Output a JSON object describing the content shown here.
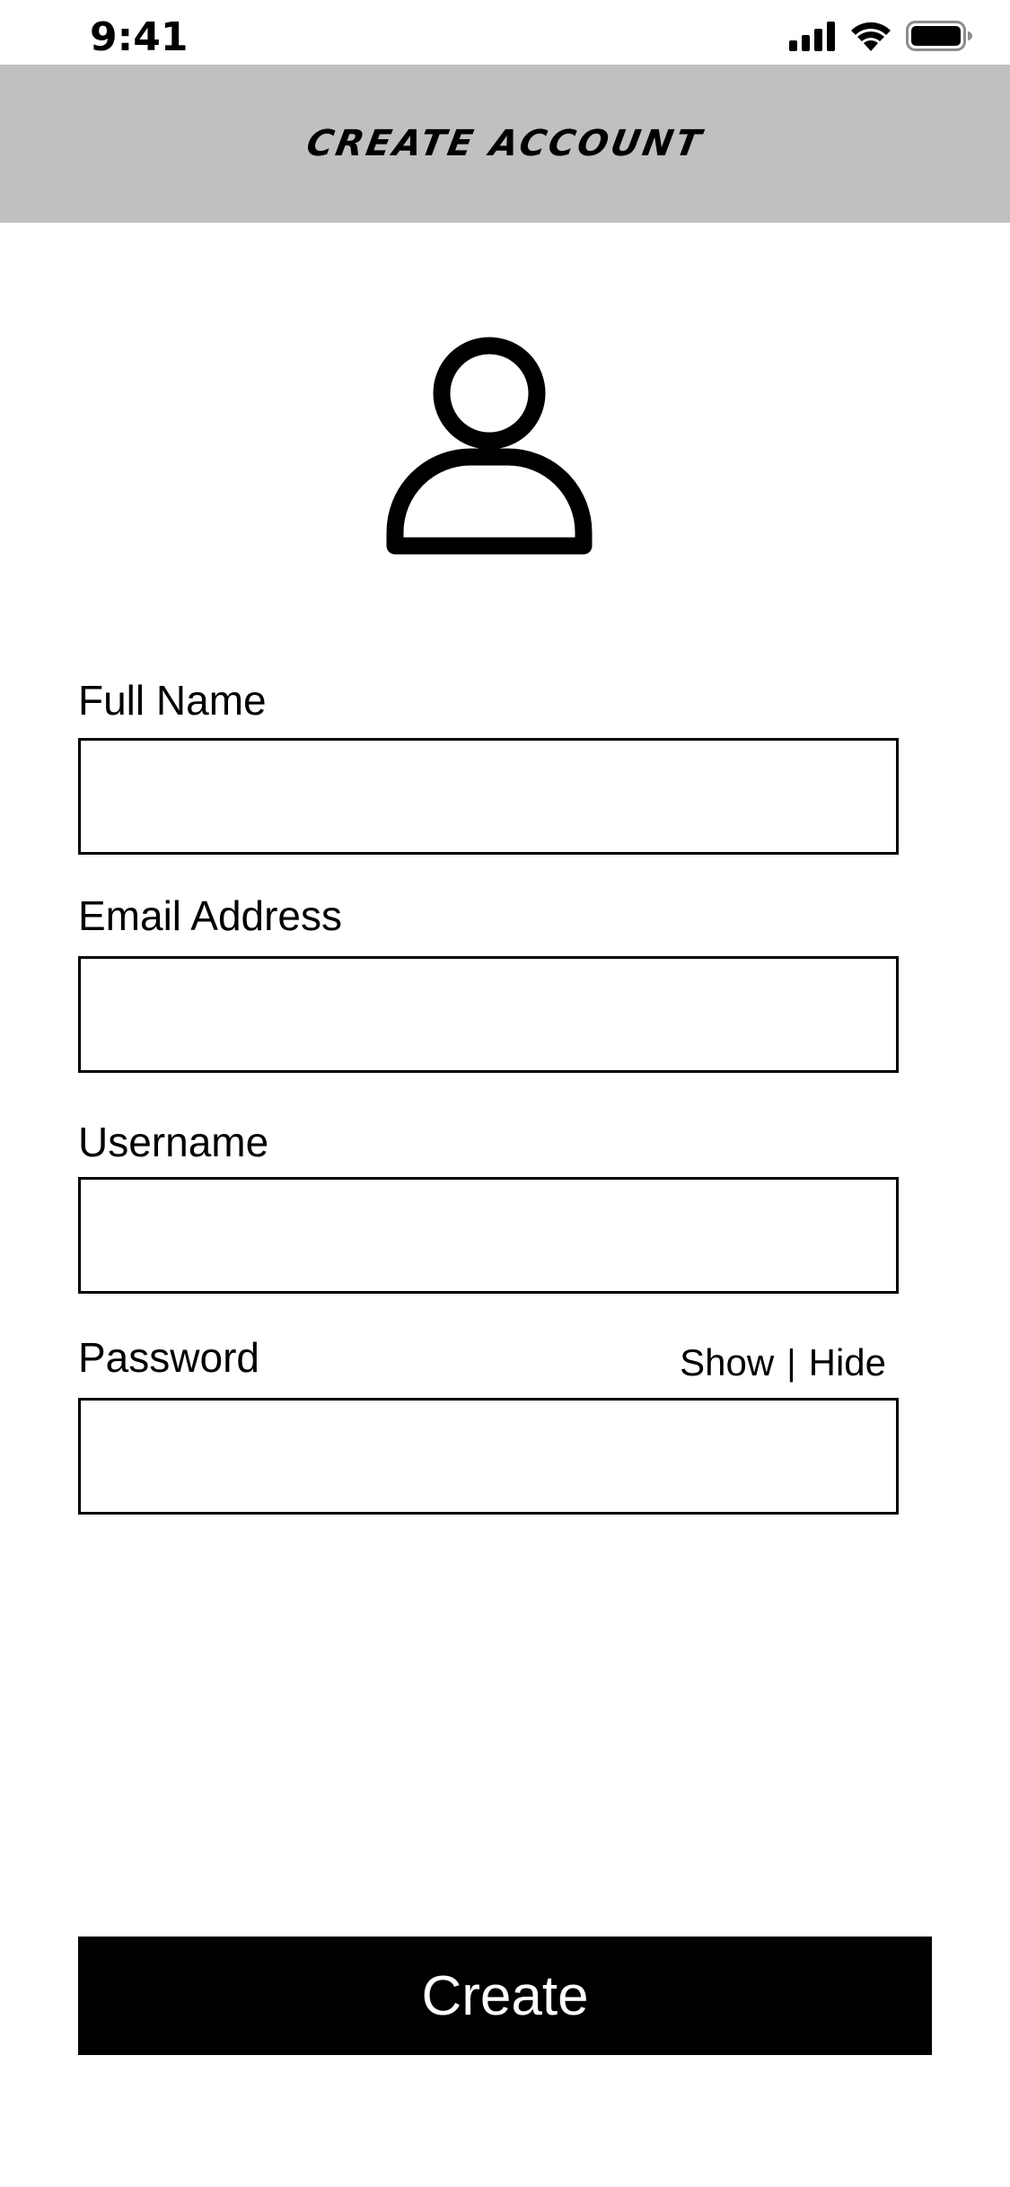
{
  "status_bar": {
    "time": "9:41",
    "icons": [
      "cellular-signal-icon",
      "wifi-icon",
      "battery-icon"
    ]
  },
  "header": {
    "title": "CREATE ACCOUNT",
    "background_color": "#c0c0c0"
  },
  "avatar": {
    "icon": "user-avatar-icon"
  },
  "form": {
    "full_name": {
      "label": "Full Name",
      "value": "",
      "placeholder": ""
    },
    "email": {
      "label": "Email Address",
      "value": "",
      "placeholder": ""
    },
    "username": {
      "label": "Username",
      "value": "",
      "placeholder": ""
    },
    "password": {
      "label": "Password",
      "value": "",
      "placeholder": "",
      "show_label": "Show",
      "separator": "|",
      "hide_label": "Hide"
    }
  },
  "actions": {
    "create_label": "Create",
    "create_background": "#000000",
    "create_text_color": "#ffffff"
  }
}
